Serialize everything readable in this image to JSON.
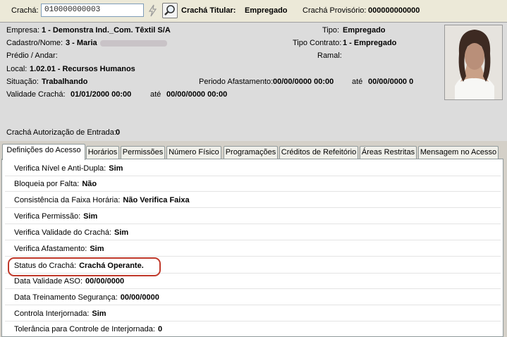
{
  "header": {
    "cracha_label": "Crachá:",
    "cracha_value": "010000000003",
    "titular_label": "Crachá Titular:",
    "titular_value": "Empregado",
    "provisorio_label": "Crachá Provisório:",
    "provisorio_value": "000000000000"
  },
  "info": {
    "empresa_label": "Empresa:",
    "empresa_value": "1 - Demonstra Ind._Com. Têxtil S/A",
    "cadastro_label": "Cadastro/Nome:",
    "cadastro_value": "3 - Maria",
    "predio_label": "Prédio / Andar:",
    "local_label": "Local:",
    "local_value": "1.02.01 - Recursos Humanos",
    "situacao_label": "Situação:",
    "situacao_value": "Trabalhando",
    "validade_label": "Validade Crachá:",
    "validade_from": "01/01/2000 00:00",
    "ate1": "até",
    "validade_to": "00/00/0000 00:00",
    "tipo_label": "Tipo:",
    "tipo_value": "Empregado",
    "tipo_contrato_label": "Tipo Contrato:",
    "tipo_contrato_value": "1 - Empregado",
    "ramal_label": "Ramal:",
    "afast_label": "Periodo Afastamento:",
    "afast_from": "00/00/0000 00:00",
    "ate2": "até",
    "afast_to": "00/00/0000 0",
    "autorizacao_label": "Crachá Autorização de Entrada:",
    "autorizacao_value": "0"
  },
  "tabs": [
    {
      "label": "Definições do Acesso"
    },
    {
      "label": "Horários"
    },
    {
      "label": "Permissões"
    },
    {
      "label": "Número Físico"
    },
    {
      "label": "Programações"
    },
    {
      "label": "Créditos de Refeitório"
    },
    {
      "label": "Áreas Restritas"
    },
    {
      "label": "Mensagem no Acesso"
    }
  ],
  "rows": [
    {
      "label": "Verifica Nível e Anti-Dupla:",
      "value": "Sim"
    },
    {
      "label": "Bloqueia por Falta:",
      "value": "Não"
    },
    {
      "label": "Consistência da Faixa Horária:",
      "value": "Não Verifica Faixa"
    },
    {
      "label": "Verifica Permissão:",
      "value": "Sim"
    },
    {
      "label": "Verifica Validade do Crachá:",
      "value": "Sim"
    },
    {
      "label": "Verifica Afastamento:",
      "value": "Sim"
    },
    {
      "label": "Status do Crachá:",
      "value": "Crachá Operante."
    },
    {
      "label": "Data Validade ASO:",
      "value": "00/00/0000"
    },
    {
      "label": "Data Treinamento Segurança:",
      "value": "00/00/0000"
    },
    {
      "label": "Controla Interjornada:",
      "value": "Sim"
    },
    {
      "label": "Tolerância para Controle de Interjornada:",
      "value": "0"
    }
  ],
  "colors": {
    "highlight": "#c0392b",
    "panel": "#dcdcdc"
  },
  "icons": [
    "flash-icon",
    "search-icon"
  ]
}
